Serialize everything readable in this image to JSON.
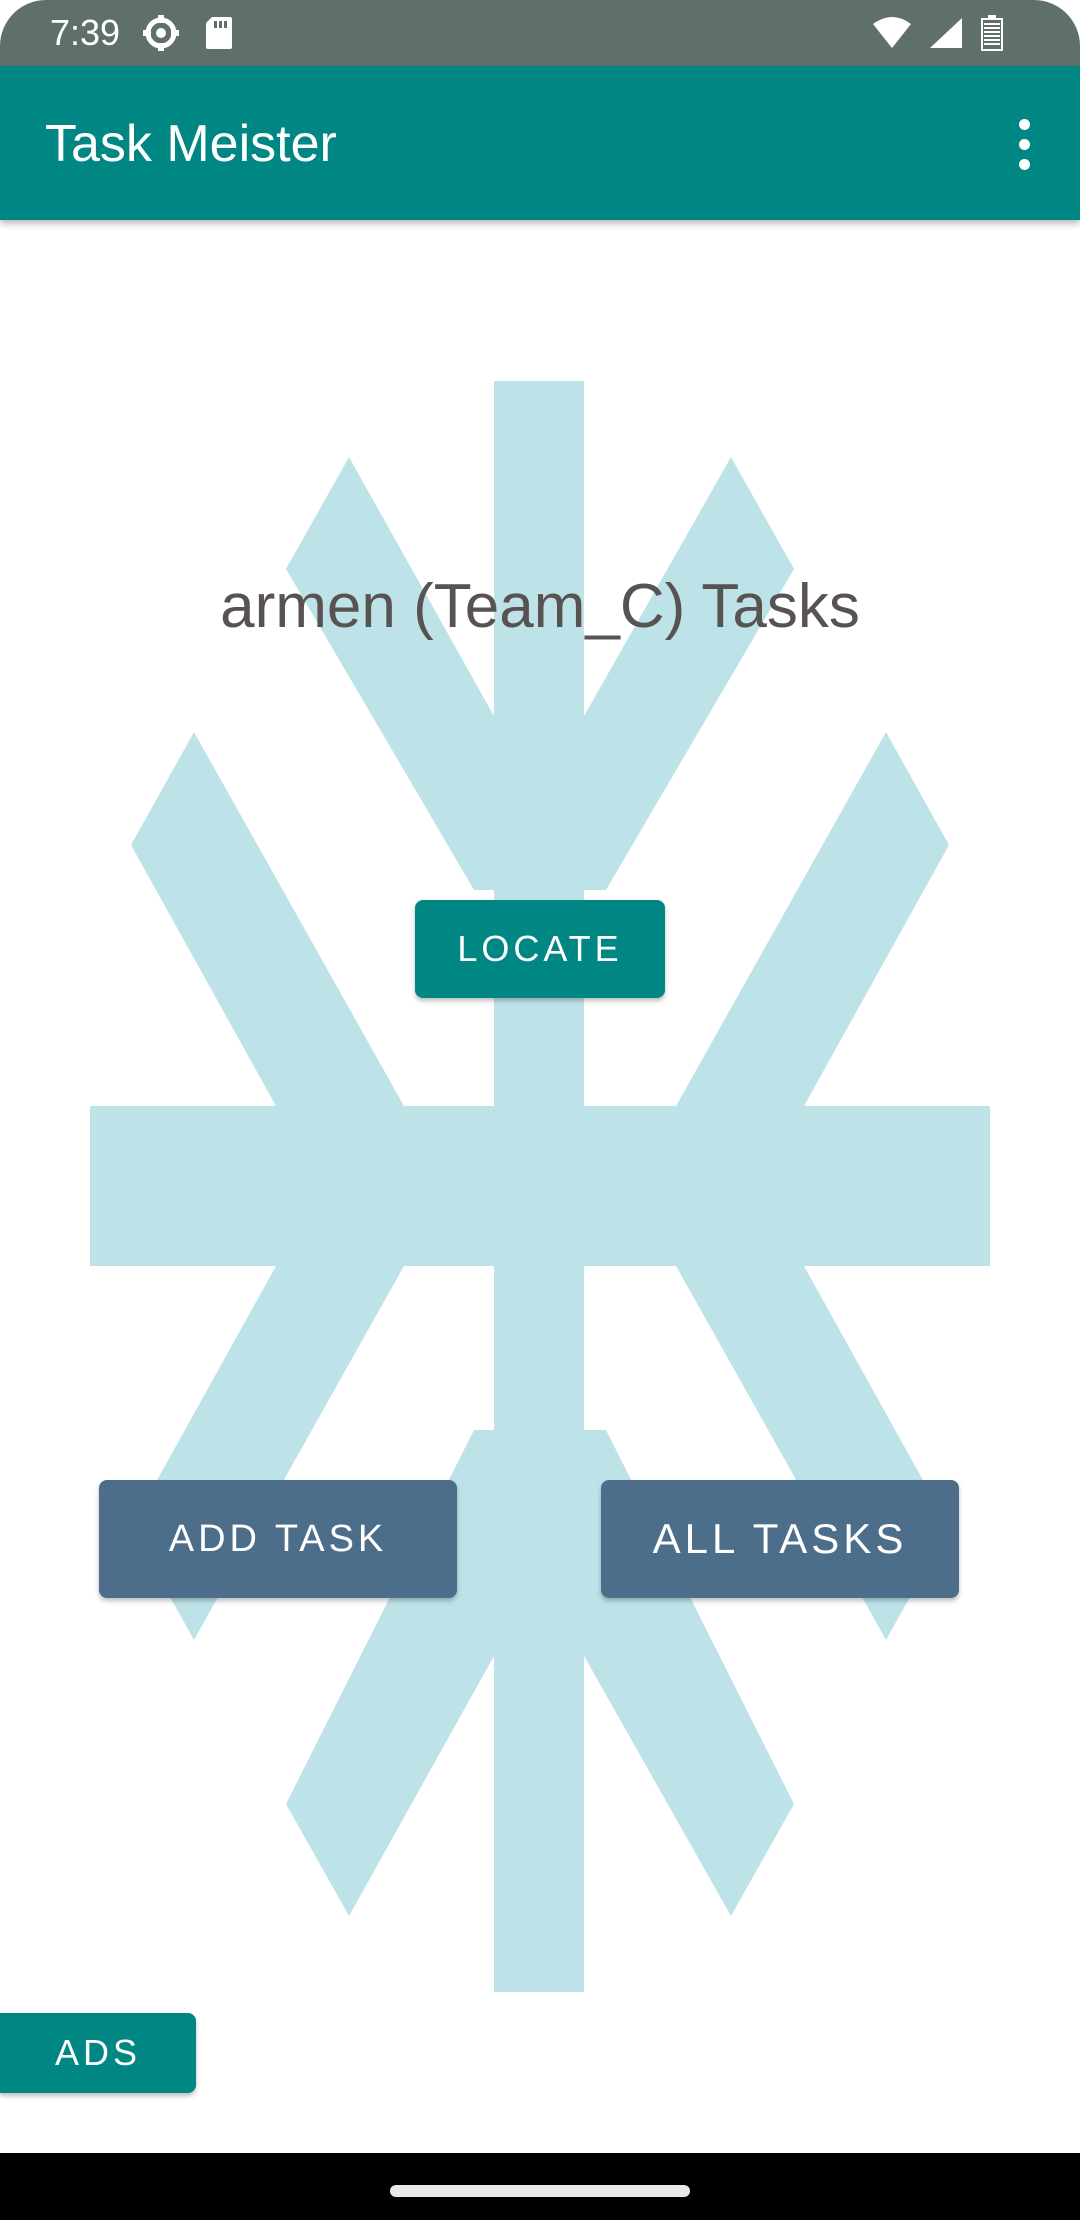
{
  "status_bar": {
    "time": "7:39",
    "left_icons": [
      "settings-gear-icon",
      "sd-card-icon"
    ],
    "right_icons": [
      "wifi-icon",
      "cell-signal-icon",
      "battery-icon"
    ]
  },
  "app_bar": {
    "title": "Task Meister",
    "menu_icon": "overflow-menu-icon"
  },
  "main": {
    "heading": "armen (Team_C) Tasks",
    "locate_label": "LOCATE",
    "add_task_label": "ADD TASK",
    "all_tasks_label": "ALL TASKS",
    "ads_label": "ADS",
    "background_emblem": "snowflake-emblem"
  },
  "colors": {
    "status_bar": "#5f6f6a",
    "primary": "#008784",
    "secondary_button": "#4d6e8a",
    "emblem": "#bde3e9",
    "heading_text": "#585352"
  },
  "nav_bar": {
    "indicator": "home-indicator"
  }
}
